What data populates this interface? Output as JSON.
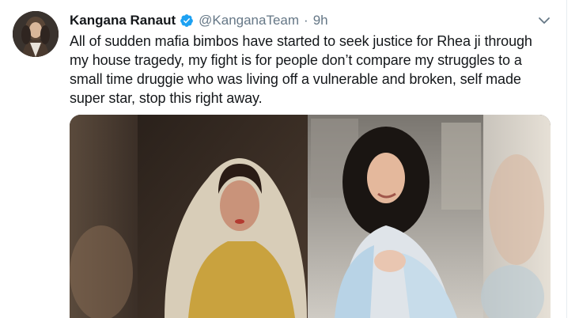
{
  "tweet": {
    "author_name": "Kangana Ranaut",
    "handle": "@KanganaTeam",
    "separator": "·",
    "time": "9h",
    "text": "All of sudden mafia bimbos have started to seek justice for Rhea ji through my house tragedy, my fight is for people don’t compare my struggles to  a small time druggie who was living off a vulnerable and broken, self made super star, stop this right away."
  },
  "colors": {
    "verified": "#1da1f2",
    "secondary_text": "#657786",
    "primary_text": "#14171a"
  },
  "icons": {
    "verified": "verified-badge-icon",
    "caret": "chevron-down-icon"
  }
}
